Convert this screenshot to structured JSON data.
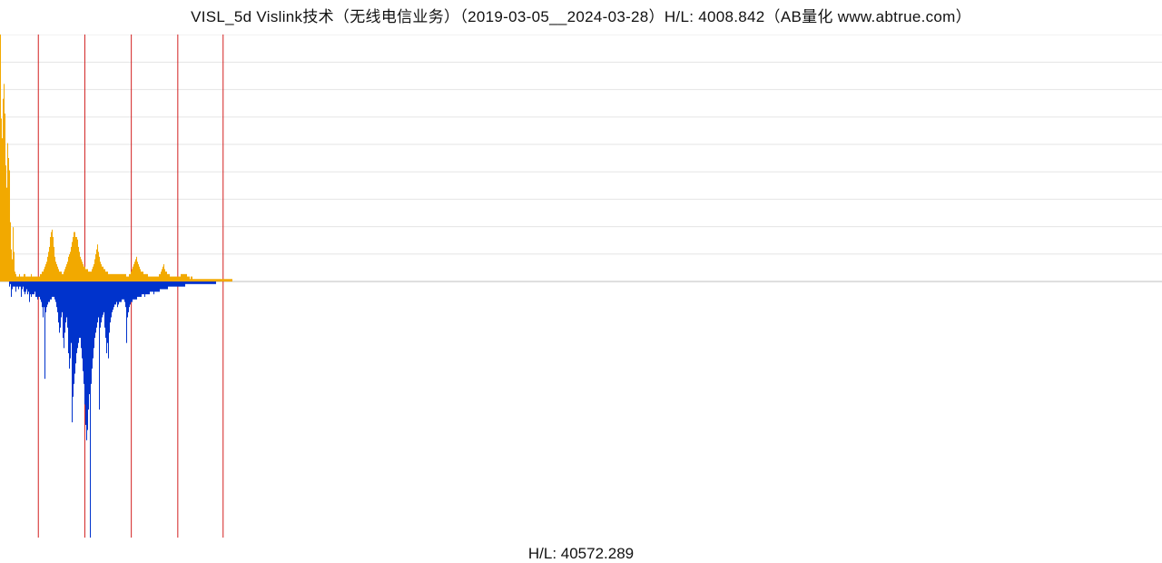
{
  "title": "VISL_5d Vislink技术（无线电信业务）（2019-03-05__2024-03-28）H/L: 4008.842（AB量化  www.abtrue.com）",
  "subtitle": "H/L: 40572.289",
  "colors": {
    "upper_series": "#f2a900",
    "lower_series": "#0033cc",
    "vertical_marker": "#d22020",
    "gridline": "#e5e5e5"
  },
  "chart_data": {
    "type": "bar",
    "title": "VISL_5d Vislink技术（无线电信业务）（2019-03-05__2024-03-28）H/L: 4008.842（AB量化  www.abtrue.com）",
    "xlabel": "",
    "ylabel": "",
    "x_range_fraction": [
      0,
      1
    ],
    "data_extent_fraction": 0.2,
    "upper_panel": {
      "hl_ratio": 4008.842,
      "baseline_rel": 0.0,
      "ylim_rel": [
        0,
        1
      ],
      "gridlines_rel": [
        0.0,
        0.111,
        0.222,
        0.333,
        0.444,
        0.555,
        0.666,
        0.777,
        0.888,
        1.0
      ],
      "values_rel": [
        1.0,
        0.66,
        0.58,
        0.74,
        0.8,
        0.68,
        0.47,
        0.38,
        0.56,
        0.5,
        0.45,
        0.24,
        0.13,
        0.09,
        0.22,
        0.12,
        0.04,
        0.03,
        0.02,
        0.02,
        0.02,
        0.03,
        0.02,
        0.02,
        0.02,
        0.02,
        0.03,
        0.03,
        0.02,
        0.02,
        0.02,
        0.02,
        0.02,
        0.02,
        0.03,
        0.02,
        0.02,
        0.02,
        0.02,
        0.02,
        0.02,
        0.02,
        0.02,
        0.02,
        0.03,
        0.03,
        0.04,
        0.04,
        0.05,
        0.06,
        0.07,
        0.08,
        0.1,
        0.12,
        0.14,
        0.18,
        0.2,
        0.21,
        0.18,
        0.14,
        0.1,
        0.08,
        0.07,
        0.06,
        0.05,
        0.04,
        0.04,
        0.04,
        0.03,
        0.03,
        0.04,
        0.05,
        0.06,
        0.07,
        0.08,
        0.1,
        0.11,
        0.12,
        0.14,
        0.16,
        0.18,
        0.2,
        0.2,
        0.18,
        0.18,
        0.17,
        0.14,
        0.12,
        0.1,
        0.09,
        0.08,
        0.07,
        0.06,
        0.06,
        0.05,
        0.05,
        0.05,
        0.04,
        0.04,
        0.04,
        0.04,
        0.05,
        0.06,
        0.07,
        0.09,
        0.11,
        0.13,
        0.15,
        0.12,
        0.1,
        0.08,
        0.07,
        0.06,
        0.06,
        0.05,
        0.05,
        0.04,
        0.04,
        0.04,
        0.03,
        0.03,
        0.03,
        0.03,
        0.03,
        0.03,
        0.03,
        0.03,
        0.03,
        0.03,
        0.03,
        0.03,
        0.03,
        0.03,
        0.03,
        0.03,
        0.03,
        0.03,
        0.03,
        0.03,
        0.02,
        0.02,
        0.02,
        0.03,
        0.03,
        0.04,
        0.05,
        0.06,
        0.07,
        0.08,
        0.09,
        0.1,
        0.08,
        0.07,
        0.06,
        0.05,
        0.04,
        0.04,
        0.04,
        0.03,
        0.03,
        0.03,
        0.03,
        0.03,
        0.02,
        0.02,
        0.02,
        0.02,
        0.02,
        0.02,
        0.02,
        0.02,
        0.02,
        0.02,
        0.02,
        0.02,
        0.03,
        0.03,
        0.04,
        0.05,
        0.06,
        0.07,
        0.05,
        0.04,
        0.04,
        0.03,
        0.03,
        0.03,
        0.02,
        0.02,
        0.02,
        0.02,
        0.02,
        0.02,
        0.02,
        0.02,
        0.02,
        0.02,
        0.02,
        0.02,
        0.03,
        0.03,
        0.03,
        0.03,
        0.03,
        0.03,
        0.03,
        0.02,
        0.02,
        0.02,
        0.01,
        0.02,
        0.02,
        0.01,
        0.01,
        0.01,
        0.01,
        0.01,
        0.01,
        0.01,
        0.01,
        0.01,
        0.01,
        0.01,
        0.01,
        0.01,
        0.01,
        0.01,
        0.01,
        0.01,
        0.01,
        0.01,
        0.01,
        0.01,
        0.01,
        0.01,
        0.01,
        0.01,
        0.01,
        0.01,
        0.01,
        0.01,
        0.01,
        0.01,
        0.01,
        0.01,
        0.01,
        0.01,
        0.01,
        0.01,
        0.01,
        0.01,
        0.01,
        0.01,
        0.01,
        0.01,
        0.01
      ]
    },
    "lower_panel": {
      "hl_ratio": 40572.289,
      "baseline_rel": 0.0,
      "ylim_rel": [
        0,
        1
      ],
      "values_rel": [
        0.0,
        0.0,
        0.0,
        0.0,
        0.0,
        0.0,
        0.0,
        0.0,
        0.0,
        0.0,
        0.02,
        0.01,
        0.06,
        0.03,
        0.02,
        0.02,
        0.02,
        0.04,
        0.02,
        0.02,
        0.03,
        0.02,
        0.02,
        0.06,
        0.03,
        0.02,
        0.04,
        0.05,
        0.04,
        0.03,
        0.05,
        0.04,
        0.08,
        0.05,
        0.06,
        0.05,
        0.05,
        0.05,
        0.04,
        0.06,
        0.06,
        0.07,
        0.06,
        0.06,
        0.07,
        0.08,
        0.1,
        0.14,
        0.1,
        0.38,
        0.12,
        0.1,
        0.09,
        0.08,
        0.08,
        0.07,
        0.07,
        0.06,
        0.06,
        0.06,
        0.07,
        0.08,
        0.1,
        0.12,
        0.16,
        0.2,
        0.18,
        0.14,
        0.12,
        0.22,
        0.26,
        0.2,
        0.16,
        0.14,
        0.18,
        0.28,
        0.34,
        0.3,
        0.24,
        0.55,
        0.45,
        0.4,
        0.36,
        0.32,
        0.28,
        0.26,
        0.24,
        0.22,
        0.22,
        0.26,
        0.3,
        0.35,
        0.4,
        0.48,
        0.56,
        0.62,
        0.58,
        0.5,
        0.44,
        1.0,
        0.4,
        0.34,
        0.3,
        0.26,
        0.22,
        0.2,
        0.18,
        0.16,
        0.14,
        0.5,
        0.18,
        0.16,
        0.14,
        0.13,
        0.12,
        0.18,
        0.22,
        0.28,
        0.24,
        0.3,
        0.2,
        0.16,
        0.14,
        0.12,
        0.11,
        0.1,
        0.09,
        0.09,
        0.08,
        0.1,
        0.09,
        0.08,
        0.08,
        0.08,
        0.07,
        0.07,
        0.07,
        0.08,
        0.1,
        0.24,
        0.14,
        0.12,
        0.1,
        0.09,
        0.08,
        0.08,
        0.07,
        0.07,
        0.07,
        0.07,
        0.07,
        0.06,
        0.06,
        0.06,
        0.06,
        0.06,
        0.05,
        0.05,
        0.05,
        0.06,
        0.05,
        0.05,
        0.05,
        0.05,
        0.05,
        0.04,
        0.04,
        0.04,
        0.04,
        0.05,
        0.04,
        0.04,
        0.04,
        0.04,
        0.04,
        0.04,
        0.03,
        0.03,
        0.03,
        0.03,
        0.03,
        0.03,
        0.03,
        0.03,
        0.03,
        0.02,
        0.02,
        0.02,
        0.02,
        0.02,
        0.02,
        0.02,
        0.02,
        0.02,
        0.02,
        0.02,
        0.02,
        0.02,
        0.02,
        0.02,
        0.02,
        0.02,
        0.02,
        0.02,
        0.01,
        0.01,
        0.01,
        0.01,
        0.01,
        0.01,
        0.01,
        0.01,
        0.01,
        0.01,
        0.01,
        0.01,
        0.01,
        0.01,
        0.01,
        0.01,
        0.01,
        0.01,
        0.01,
        0.01,
        0.01,
        0.01,
        0.01,
        0.01,
        0.01,
        0.01,
        0.01,
        0.01,
        0.01,
        0.01,
        0.01,
        0.01,
        0.01,
        0.01,
        0.0,
        0.0,
        0.0,
        0.0,
        0.0,
        0.0,
        0.0,
        0.0,
        0.0,
        0.0,
        0.0,
        0.0,
        0.0,
        0.0,
        0.0,
        0.0,
        0.0,
        0.0
      ]
    },
    "vertical_markers_x_fraction": [
      0.033,
      0.073,
      0.113,
      0.153,
      0.192
    ]
  }
}
